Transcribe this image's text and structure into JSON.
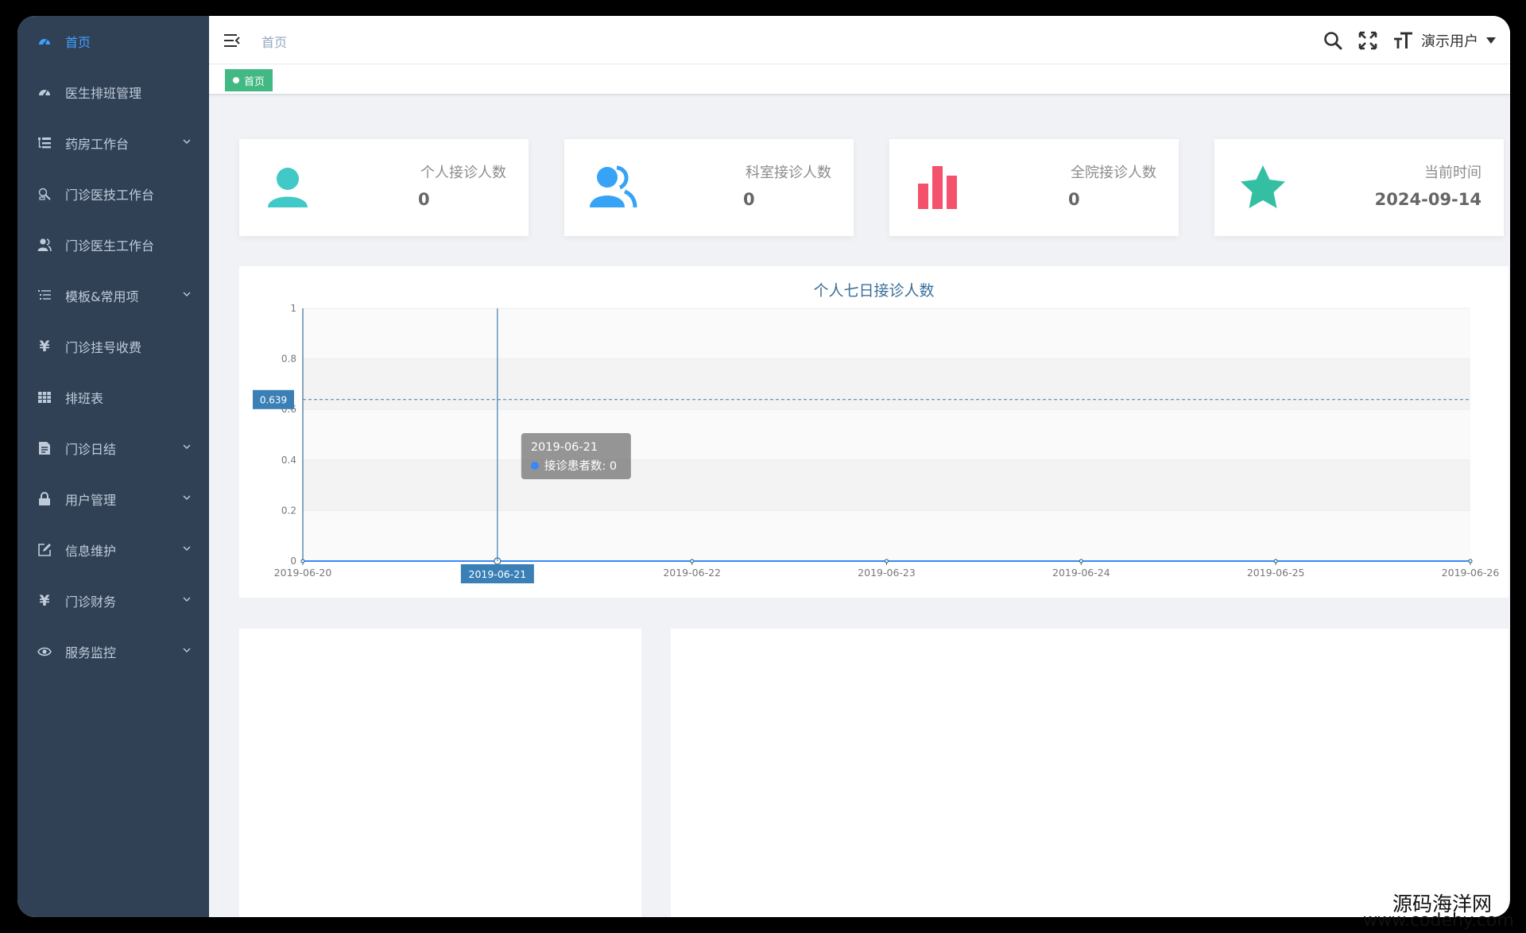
{
  "sidebar": {
    "items": [
      {
        "label": "首页",
        "icon": "dashboard-icon",
        "active": true,
        "has_submenu": false
      },
      {
        "label": "医生排班管理",
        "icon": "dashboard-icon",
        "active": false,
        "has_submenu": false
      },
      {
        "label": "药房工作台",
        "icon": "tree-table-icon",
        "active": false,
        "has_submenu": true
      },
      {
        "label": "门诊医技工作台",
        "icon": "tool-icon",
        "active": false,
        "has_submenu": false
      },
      {
        "label": "门诊医生工作台",
        "icon": "peoples-icon",
        "active": false,
        "has_submenu": false
      },
      {
        "label": "模板&常用项",
        "icon": "list-icon",
        "active": false,
        "has_submenu": true
      },
      {
        "label": "门诊挂号收费",
        "icon": "yen-icon",
        "active": false,
        "has_submenu": false
      },
      {
        "label": "排班表",
        "icon": "table-icon",
        "active": false,
        "has_submenu": false
      },
      {
        "label": "门诊日结",
        "icon": "document-icon",
        "active": false,
        "has_submenu": true
      },
      {
        "label": "用户管理",
        "icon": "lock-icon",
        "active": false,
        "has_submenu": true
      },
      {
        "label": "信息维护",
        "icon": "edit-icon",
        "active": false,
        "has_submenu": true
      },
      {
        "label": "门诊财务",
        "icon": "yen-icon",
        "active": false,
        "has_submenu": true
      },
      {
        "label": "服务监控",
        "icon": "eye-icon",
        "active": false,
        "has_submenu": true
      }
    ]
  },
  "topbar": {
    "breadcrumb": "首页",
    "user_name": "演示用户",
    "tools": [
      "search-icon",
      "fullscreen-icon",
      "font-size-icon"
    ]
  },
  "tags": {
    "active_tag": "首页"
  },
  "cards": [
    {
      "label": "个人接诊人数",
      "value": "0",
      "icon": "user-icon",
      "color": "#40c9c6"
    },
    {
      "label": "科室接诊人数",
      "value": "0",
      "icon": "peoples-icon",
      "color": "#36a3f7"
    },
    {
      "label": "全院接诊人数",
      "value": "0",
      "icon": "bar-chart-icon",
      "color": "#f4516c"
    },
    {
      "label": "当前时间",
      "value": "2024-09-14",
      "icon": "star-icon",
      "color": "#34bfa3"
    }
  ],
  "chart_data": {
    "type": "line",
    "title": "个人七日接诊人数",
    "categories": [
      "2019-06-20",
      "2019-06-21",
      "2019-06-22",
      "2019-06-23",
      "2019-06-24",
      "2019-06-25",
      "2019-06-26"
    ],
    "series": [
      {
        "name": "接诊患者数",
        "values": [
          0,
          0,
          0,
          0,
          0,
          0,
          0
        ],
        "color": "#3888fa"
      }
    ],
    "ylim": [
      0,
      1
    ],
    "yticks": [
      "0",
      "0.2",
      "0.4",
      "0.6",
      "0.8",
      "1"
    ],
    "grid": true,
    "pointer": {
      "x_label": "2019-06-21",
      "y_label": "0.639",
      "y_value": 0.639
    },
    "tooltip": {
      "date": "2019-06-21",
      "line": "接诊患者数: 0"
    }
  },
  "watermark": {
    "line1": "源码海洋网",
    "line2": "www.codehy.com"
  }
}
